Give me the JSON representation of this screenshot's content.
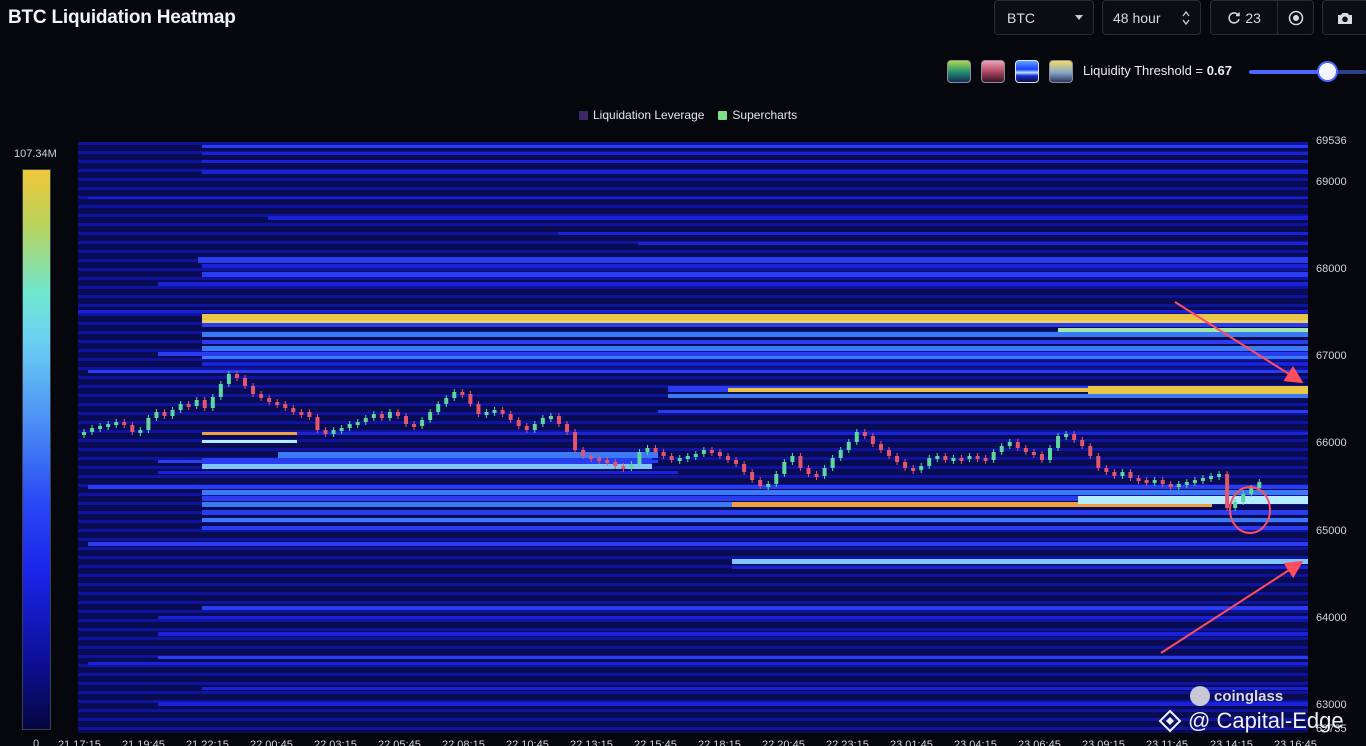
{
  "header": {
    "title": "BTC Liquidation Heatmap"
  },
  "controls": {
    "coin": "BTC",
    "range": "48 hour",
    "refresh_count": "23"
  },
  "threshold": {
    "label": "Liquidity Threshold = ",
    "value": "0.67",
    "fraction": 0.67
  },
  "legend": [
    {
      "label": "Liquidation Leverage",
      "color": "#3b2a66"
    },
    {
      "label": "Supercharts",
      "color": "#7ee08a"
    }
  ],
  "scale": {
    "max": "107.34M",
    "min": "0"
  },
  "axis": {
    "y_ticks": [
      "69536",
      "69000",
      "68000",
      "67000",
      "66000",
      "65000",
      "64000",
      "63000",
      "62735"
    ],
    "x_ticks": [
      "21 17:15",
      "21 19:45",
      "21 22:15",
      "22 00:45",
      "22 03:15",
      "22 05:45",
      "22 08:15",
      "22 10:45",
      "22 13:15",
      "22 15:45",
      "22 18:15",
      "22 20:45",
      "22 23:15",
      "23 01:45",
      "23 04:15",
      "23 06:45",
      "23 09:15",
      "23 11:45",
      "23 14:15",
      "23 16:45"
    ]
  },
  "watermark": {
    "brand": "coinglass",
    "credit": "@ Capital-Edge"
  },
  "colors": {
    "accent": "#4a67ff",
    "up": "#5fd6a0",
    "down": "#e2566b",
    "annotation": "#ff4d5e"
  }
}
